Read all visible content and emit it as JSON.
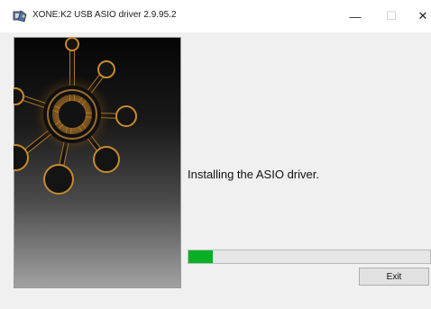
{
  "window": {
    "title": "XONE:K2 USB ASIO driver 2.9.95.2",
    "icons": {
      "app": "installer-app-icon",
      "minimize": "minimize-icon",
      "maximize": "maximize-icon",
      "close": "close-icon"
    },
    "controls": {
      "minimize_glyph": "—",
      "maximize_glyph": "☐",
      "close_glyph": "✕"
    }
  },
  "banner": {
    "graphic": "network-node-graphic"
  },
  "main": {
    "status": "Installing the ASIO driver.",
    "progress_fraction": 0.1,
    "exit_label": "Exit"
  },
  "colors": {
    "progress": "#06b025",
    "node_glow": "#c88a2a"
  }
}
